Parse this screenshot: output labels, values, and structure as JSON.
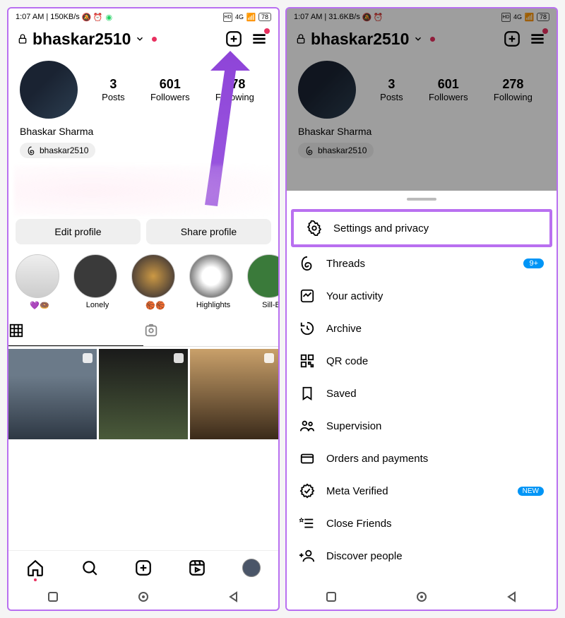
{
  "screen1": {
    "statusbar": {
      "time": "1:07 AM",
      "speed": "150KB/s",
      "net": "4G",
      "battery": "78"
    },
    "header": {
      "username": "bhaskar2510"
    },
    "stats": {
      "posts_num": "3",
      "posts_lbl": "Posts",
      "followers_num": "601",
      "followers_lbl": "Followers",
      "following_num": "278",
      "following_lbl": "Following"
    },
    "display_name": "Bhaskar Sharma",
    "threads_handle": "bhaskar2510",
    "buttons": {
      "edit": "Edit profile",
      "share": "Share profile"
    },
    "highlights": [
      {
        "caption": "💜🍩"
      },
      {
        "caption": "Lonely"
      },
      {
        "caption": "🏀🏀"
      },
      {
        "caption": "Highlights"
      },
      {
        "caption": "Sill-B"
      }
    ]
  },
  "screen2": {
    "statusbar": {
      "time": "1:07 AM",
      "speed": "31.6KB/s",
      "net": "4G",
      "battery": "78"
    },
    "header": {
      "username": "bhaskar2510"
    },
    "stats": {
      "posts_num": "3",
      "posts_lbl": "Posts",
      "followers_num": "601",
      "followers_lbl": "Followers",
      "following_num": "278",
      "following_lbl": "Following"
    },
    "display_name": "Bhaskar Sharma",
    "threads_handle": "bhaskar2510",
    "menu": {
      "settings": "Settings and privacy",
      "threads": "Threads",
      "threads_badge": "9+",
      "activity": "Your activity",
      "archive": "Archive",
      "qr": "QR code",
      "saved": "Saved",
      "supervision": "Supervision",
      "orders": "Orders and payments",
      "meta": "Meta Verified",
      "meta_badge": "NEW",
      "close_friends": "Close Friends",
      "discover": "Discover people"
    }
  }
}
